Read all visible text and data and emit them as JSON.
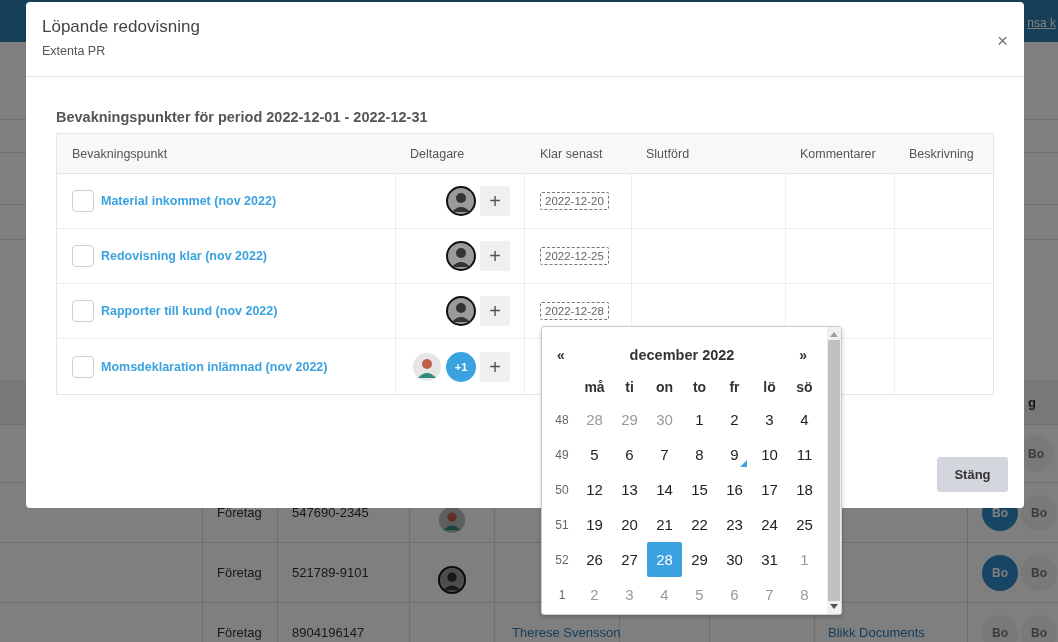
{
  "background": {
    "header_link": "nsa k",
    "table": {
      "header_fragment": "g",
      "rows": [
        {
          "badges": [
            {
              "label": "Bo",
              "active": false
            }
          ]
        },
        {
          "type": "Företag",
          "number": "547690-2345",
          "avatar": {
            "kind": "cartoon"
          },
          "badges": [
            {
              "label": "Bo",
              "active": true
            },
            {
              "label": "Bo",
              "active": false
            }
          ]
        },
        {
          "type": "Företag",
          "number": "521789-9101",
          "avatar": {
            "kind": "photo"
          },
          "badges": [
            {
              "label": "Bo",
              "active": true
            },
            {
              "label": "Bo",
              "active": false
            }
          ]
        },
        {
          "type": "Företag",
          "number": "8904196147",
          "name": "Therese Svensson",
          "company": "Blikk Documents",
          "badges": [
            {
              "label": "Bo",
              "active": false
            },
            {
              "label": "Bo",
              "active": false
            }
          ]
        }
      ]
    }
  },
  "dialog": {
    "title": "Löpande redovisning",
    "subtitle": "Extenta PR",
    "close": "×",
    "section_title": "Bevakningspunkter för period 2022-12-01 - 2022-12-31",
    "table": {
      "columns": [
        "Bevakningspunkt",
        "Deltagare",
        "Klar senast",
        "Slutförd",
        "Kommentarer",
        "Beskrivning"
      ],
      "rows": [
        {
          "checked": false,
          "title": "Material inkommet (nov 2022)",
          "participants": [
            {
              "kind": "photo"
            }
          ],
          "add": "+",
          "due": "2022-12-20"
        },
        {
          "checked": false,
          "title": "Redovisning klar (nov 2022)",
          "participants": [
            {
              "kind": "photo"
            }
          ],
          "add": "+",
          "due": "2022-12-25"
        },
        {
          "checked": false,
          "title": "Rapporter till kund (nov 2022)",
          "participants": [
            {
              "kind": "photo"
            }
          ],
          "add": "+",
          "due": "2022-12-28"
        },
        {
          "checked": false,
          "title": "Momsdeklaration inlämnad (nov 2022)",
          "participants": [
            {
              "kind": "cartoon"
            },
            {
              "kind": "more",
              "label": "+1"
            }
          ],
          "add": "+"
        }
      ]
    },
    "close_button": "Stäng"
  },
  "datepicker": {
    "prev": "«",
    "month": "december 2022",
    "next": "»",
    "weekdays": [
      "må",
      "ti",
      "on",
      "to",
      "fr",
      "lö",
      "sö"
    ],
    "weeks": [
      {
        "week": "48",
        "days": [
          {
            "label": "28",
            "muted": true,
            "selected": false,
            "marked": false
          },
          {
            "label": "29",
            "muted": true,
            "selected": false,
            "marked": false
          },
          {
            "label": "30",
            "muted": true,
            "selected": false,
            "marked": false
          },
          {
            "label": "1",
            "muted": false,
            "selected": false,
            "marked": false
          },
          {
            "label": "2",
            "muted": false,
            "selected": false,
            "marked": false
          },
          {
            "label": "3",
            "muted": false,
            "selected": false,
            "marked": false
          },
          {
            "label": "4",
            "muted": false,
            "selected": false,
            "marked": false
          }
        ]
      },
      {
        "week": "49",
        "days": [
          {
            "label": "5",
            "muted": false,
            "selected": false,
            "marked": false
          },
          {
            "label": "6",
            "muted": false,
            "selected": false,
            "marked": false
          },
          {
            "label": "7",
            "muted": false,
            "selected": false,
            "marked": false
          },
          {
            "label": "8",
            "muted": false,
            "selected": false,
            "marked": false
          },
          {
            "label": "9",
            "muted": false,
            "selected": false,
            "marked": true
          },
          {
            "label": "10",
            "muted": false,
            "selected": false,
            "marked": false
          },
          {
            "label": "11",
            "muted": false,
            "selected": false,
            "marked": false
          }
        ]
      },
      {
        "week": "50",
        "days": [
          {
            "label": "12",
            "muted": false,
            "selected": false,
            "marked": false
          },
          {
            "label": "13",
            "muted": false,
            "selected": false,
            "marked": false
          },
          {
            "label": "14",
            "muted": false,
            "selected": false,
            "marked": false
          },
          {
            "label": "15",
            "muted": false,
            "selected": false,
            "marked": false
          },
          {
            "label": "16",
            "muted": false,
            "selected": false,
            "marked": false
          },
          {
            "label": "17",
            "muted": false,
            "selected": false,
            "marked": false
          },
          {
            "label": "18",
            "muted": false,
            "selected": false,
            "marked": false
          }
        ]
      },
      {
        "week": "51",
        "days": [
          {
            "label": "19",
            "muted": false,
            "selected": false,
            "marked": false
          },
          {
            "label": "20",
            "muted": false,
            "selected": false,
            "marked": false
          },
          {
            "label": "21",
            "muted": false,
            "selected": false,
            "marked": false
          },
          {
            "label": "22",
            "muted": false,
            "selected": false,
            "marked": false
          },
          {
            "label": "23",
            "muted": false,
            "selected": false,
            "marked": false
          },
          {
            "label": "24",
            "muted": false,
            "selected": false,
            "marked": false
          },
          {
            "label": "25",
            "muted": false,
            "selected": false,
            "marked": false
          }
        ]
      },
      {
        "week": "52",
        "days": [
          {
            "label": "26",
            "muted": false,
            "selected": false,
            "marked": false
          },
          {
            "label": "27",
            "muted": false,
            "selected": false,
            "marked": false
          },
          {
            "label": "28",
            "muted": false,
            "selected": true,
            "marked": false
          },
          {
            "label": "29",
            "muted": false,
            "selected": false,
            "marked": false
          },
          {
            "label": "30",
            "muted": false,
            "selected": false,
            "marked": false
          },
          {
            "label": "31",
            "muted": false,
            "selected": false,
            "marked": false
          },
          {
            "label": "1",
            "muted": true,
            "selected": false,
            "marked": false
          }
        ]
      },
      {
        "week": "1",
        "days": [
          {
            "label": "2",
            "muted": true,
            "selected": false,
            "marked": false
          },
          {
            "label": "3",
            "muted": true,
            "selected": false,
            "marked": false
          },
          {
            "label": "4",
            "muted": true,
            "selected": false,
            "marked": false
          },
          {
            "label": "5",
            "muted": true,
            "selected": false,
            "marked": false
          },
          {
            "label": "6",
            "muted": true,
            "selected": false,
            "marked": false
          },
          {
            "label": "7",
            "muted": true,
            "selected": false,
            "marked": false
          },
          {
            "label": "8",
            "muted": true,
            "selected": false,
            "marked": false
          }
        ]
      }
    ]
  }
}
